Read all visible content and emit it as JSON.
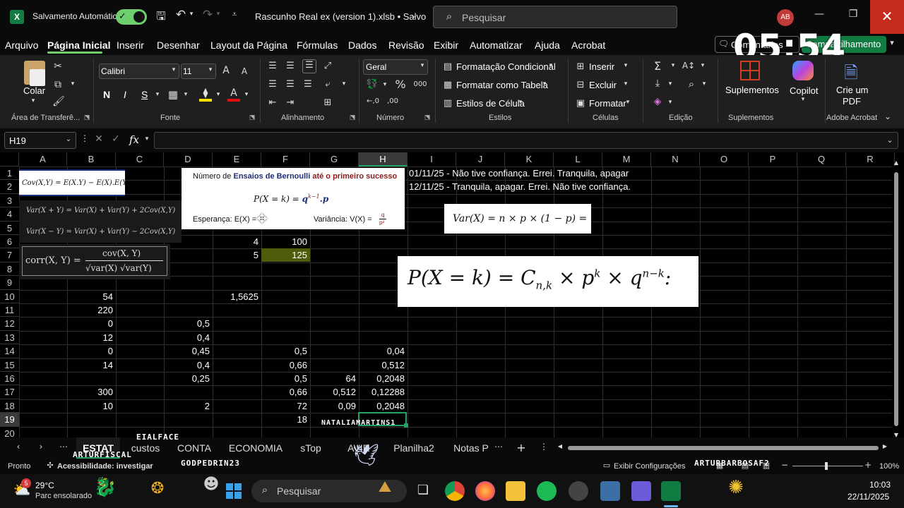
{
  "title_bar": {
    "autosave_label": "Salvamento Automático",
    "file_title": "Rascunho Real ex (version 1).xlsb • Salvo",
    "search_placeholder": "Pesquisar",
    "avatar": "AB",
    "timer": "05:54"
  },
  "menu": [
    "Arquivo",
    "Página Inicial",
    "Inserir",
    "Desenhar",
    "Layout da Página",
    "Fórmulas",
    "Dados",
    "Revisão",
    "Exibir",
    "Automatizar",
    "Ajuda",
    "Acrobat"
  ],
  "menu_right": {
    "comments": "Comentários",
    "share": "Compartilhamento"
  },
  "ribbon": {
    "clipboard": {
      "paste": "Colar",
      "group": "Área de Transferê..."
    },
    "font": {
      "family": "Calibri",
      "size": "11",
      "bold": "N",
      "italic": "I",
      "underline": "S",
      "group": "Fonte"
    },
    "alignment": {
      "group": "Alinhamento"
    },
    "number": {
      "format": "Geral",
      "group": "Número"
    },
    "styles": {
      "cond": "Formatação Condicional",
      "table": "Formatar como Tabela",
      "cell": "Estilos de Célula",
      "group": "Estilos"
    },
    "cells": {
      "insert": "Inserir",
      "delete": "Excluir",
      "format": "Formatar",
      "group": "Células"
    },
    "editing": {
      "group": "Edição"
    },
    "addins": {
      "label": "Suplementos",
      "group": "Suplementos"
    },
    "copilot": {
      "label": "Copilot"
    },
    "acrobat": {
      "label1": "Crie um",
      "label2": "PDF",
      "group": "Adobe Acrobat"
    }
  },
  "formula_bar": {
    "name_box": "H19",
    "fx": "fx",
    "formula": ""
  },
  "columns": [
    "A",
    "B",
    "C",
    "D",
    "E",
    "F",
    "G",
    "H",
    "I",
    "J",
    "K",
    "L",
    "M",
    "N",
    "O",
    "P",
    "Q",
    "R"
  ],
  "rows": [
    "1",
    "2",
    "3",
    "4",
    "5",
    "6",
    "7",
    "8",
    "9",
    "10",
    "11",
    "12",
    "13",
    "14",
    "15",
    "16",
    "17",
    "18",
    "19",
    "20"
  ],
  "cells": {
    "I1": "01/11/25 - Não tive confiança. Errei. Tranquila, apagar",
    "I2": "12/11/25 - Tranquila, apagar. Errei. Não tive confiança.",
    "E6": "4",
    "F6": "100",
    "E7": "5",
    "F7": "125",
    "B10": "54",
    "E10": "1,5625",
    "B11": "220",
    "B12": "0",
    "D12": "0,5",
    "B13": "12",
    "D13": "0,4",
    "B14": "0",
    "D14": "0,45",
    "F14": "0,5",
    "H14": "0,04",
    "B15": "14",
    "D15": "0,4",
    "F15": "0,66",
    "H15": "0,512",
    "D16": "0,25",
    "F16": "0,5",
    "G16": "64",
    "H16": "0,2048",
    "B17": "300",
    "F17": "0,66",
    "G17": "0,512",
    "H17": "0,12288",
    "B18": "10",
    "D18": "2",
    "F18": "72",
    "G18": "0,09",
    "H18": "0,2048",
    "F19": "18"
  },
  "images": {
    "cov": "Cov(X,Y) = E(X.Y) − E(X).E(Y)",
    "var_sum": "Var(X + Y) = Var(X) + Var(Y) + 2Cov(X,Y)",
    "var_diff": "Var(X − Y) = Var(X) + Var(Y) − 2Cov(X,Y)",
    "corr_left": "corr(X, Y) =",
    "corr_num": "cov(X, Y)",
    "corr_den": "√var(X) √var(Y)",
    "bern_title_a": "Número de ",
    "bern_title_b": "Ensaios de Bernoulli",
    "bern_title_c": " até o primeiro sucesso",
    "bern_formula_a": "P(X = k) = ",
    "bern_formula_b": "q",
    "bern_formula_sup": "k−1",
    "bern_formula_c": ".p",
    "bern_esp": "Esperança: E(X) =",
    "bern_var": "Variância: V(X) =",
    "bern_var_num": "q",
    "bern_var_den": "p²",
    "varbin": "Var(X) = n × p × (1 − p) =",
    "binom_a": "P(X = k) = C",
    "binom_sub": "n,k",
    "binom_b": " × p",
    "binom_sup1": "k",
    "binom_c": " × q",
    "binom_sup2": "n−k",
    "binom_d": ":"
  },
  "sheet_tabs": [
    "ESTAT",
    "custos",
    "CONTA",
    "ECONOMIA",
    "sTop",
    "AVIR",
    "Planilha2",
    "Notas P"
  ],
  "status": {
    "ready": "Pronto",
    "accessibility": "Acessibilidade: investigar",
    "display": "Exibir Configurações",
    "zoom": "100%"
  },
  "stickers": [
    "EIALFACE",
    "ARTURFISCAL",
    "GODPEDRIN23",
    "NATALIAMARTINS1",
    "ARTURBARBOSAF2"
  ],
  "taskbar": {
    "weather_temp": "29°C",
    "weather_desc": "Parc ensolarado",
    "weather_badge": "5",
    "search": "Pesquisar",
    "time": "10:03",
    "date": "22/11/2025"
  },
  "colors": {
    "accent_green": "#107c41",
    "toggle_green": "#6fcf6f",
    "cell_olive": "#4d5d0b",
    "close_red": "#c42b1c"
  }
}
